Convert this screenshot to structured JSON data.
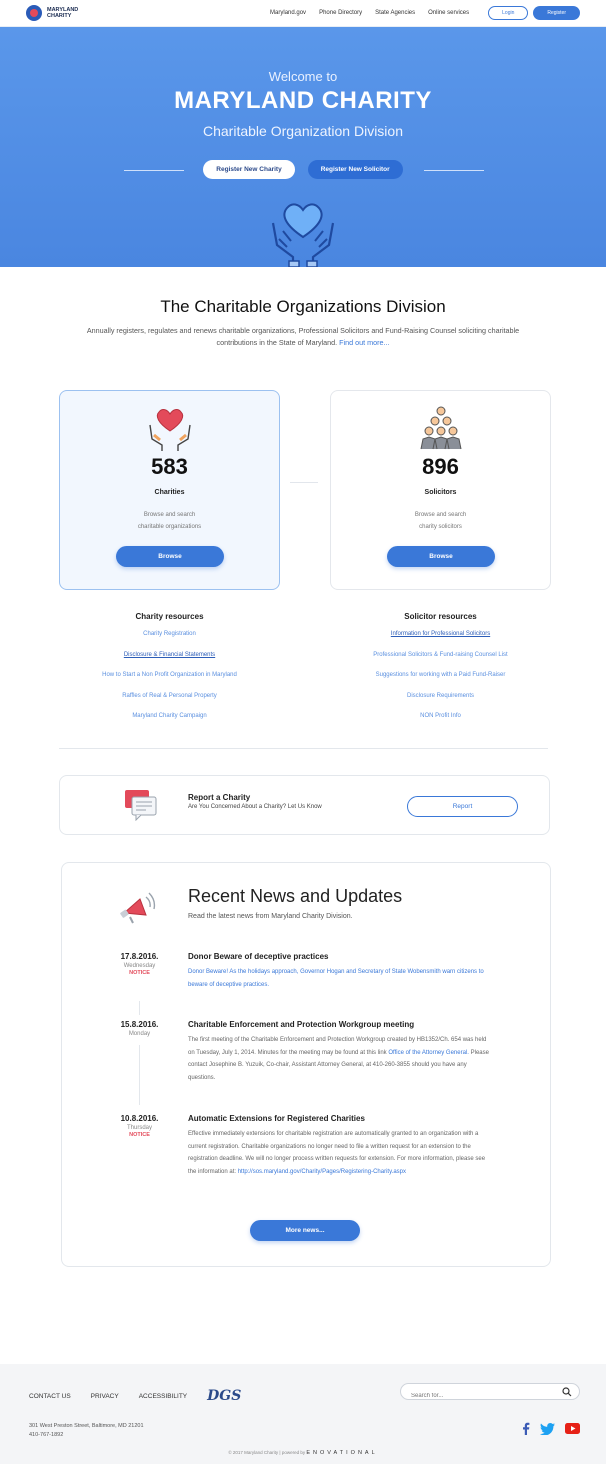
{
  "header": {
    "logo_line1": "MARYLAND",
    "logo_line2": "CHARITY",
    "nav": [
      "Maryland.gov",
      "Phone Directory",
      "State Agencies",
      "Online services"
    ],
    "login_label": "Login",
    "register_label": "Register"
  },
  "hero": {
    "welcome": "Welcome to",
    "title": "MARYLAND CHARITY",
    "subtitle": "Charitable Organization Division",
    "btn_charity": "Register New Charity",
    "btn_solicitor": "Register New Solicitor"
  },
  "intro": {
    "title": "The Charitable Organizations Division",
    "text": "Annually registers, regulates and renews charitable organizations, Professional Solicitors and Fund-Raising Counsel soliciting charitable contributions in the State of Maryland.",
    "link": "Find out more..."
  },
  "stats": {
    "charities": {
      "count": "583",
      "label": "Charities",
      "desc1": "Browse and search",
      "desc2": "charitable organizations",
      "button": "Browse"
    },
    "solicitors": {
      "count": "896",
      "label": "Solicitors",
      "desc1": "Browse and search",
      "desc2": "charity solicitors",
      "button": "Browse"
    }
  },
  "resources": {
    "charity_title": "Charity resources",
    "charity_links": [
      "Charity Registration",
      "Disclosure & Financial Statements",
      "How to Start a Non Profit Organization in Maryland",
      "Raffles of Real & Personal Property",
      "Maryland Charity Campaign"
    ],
    "solicitor_title": "Solicitor resources",
    "solicitor_links": [
      "Information for Professional Solicitors",
      "Professional Solicitors & Fund-raising Counsel List",
      "Suggestions for working with a Paid Fund-Raiser",
      "Disclosure Requirements",
      "NON Profit Info"
    ]
  },
  "report": {
    "title": "Report a Charity",
    "subtitle": "Are You Concerned About a Charity? Let Us Know",
    "button": "Report"
  },
  "news": {
    "title": "Recent News and Updates",
    "subtitle": "Read the latest news from Maryland Charity Division.",
    "items": [
      {
        "date": "17.8.2016.",
        "weekday": "Wednesday",
        "tag": "NOTICE",
        "title": "Donor Beware of deceptive practices",
        "link_text": "Donor Beware! As the holidays approach, Governor Hogan and Secretary of State Wobensmith warn citizens to beware of deceptive practices."
      },
      {
        "date": "15.8.2016.",
        "weekday": "Monday",
        "tag": "",
        "title": "Charitable Enforcement and Protection Workgroup meeting",
        "text_a": "The first meeting of the Charitable Enforcement and Protection Workgroup created by HB1352/Ch. 654 was held on Tuesday, July 1, 2014. Minutes for the meeting may be found at this link",
        "link_text": "Office of the Attorney General.",
        "text_b": "Please contact Josephine B. Yuzuik, Co-chair, Assistant Attorney General, at 410-260-3855 should you have any questions."
      },
      {
        "date": "10.8.2016.",
        "weekday": "Thursday",
        "tag": "NOTICE",
        "title": "Automatic Extensions for Registered Charities",
        "text_a": "Effective immediately extensions for charitable registration are automatically granted to an organization with a current registration. Charitable organizations no longer need to file a written request for an extension to the registration deadline. We will no longer process written requests for extension. For more information, please see the information at:",
        "link_text": "http://sos.maryland.gov/Charity/Pages/Registering-Charity.aspx"
      }
    ],
    "more_button": "More news..."
  },
  "footer": {
    "links": [
      "CONTACT US",
      "PRIVACY",
      "ACCESSIBILITY"
    ],
    "gs_logo": "DGS",
    "search_placeholder": "Search for...",
    "address": "301 West Preston Street, Baltimore, MD 21201",
    "phone": "410-767-1892",
    "copyright": "© 2017 Maryland Charity | powered by",
    "powered": "ENOVATIONAL"
  },
  "colors": {
    "accent": "#3a78d8",
    "hero": "#4a86e0",
    "notice": "#e34a5a"
  }
}
